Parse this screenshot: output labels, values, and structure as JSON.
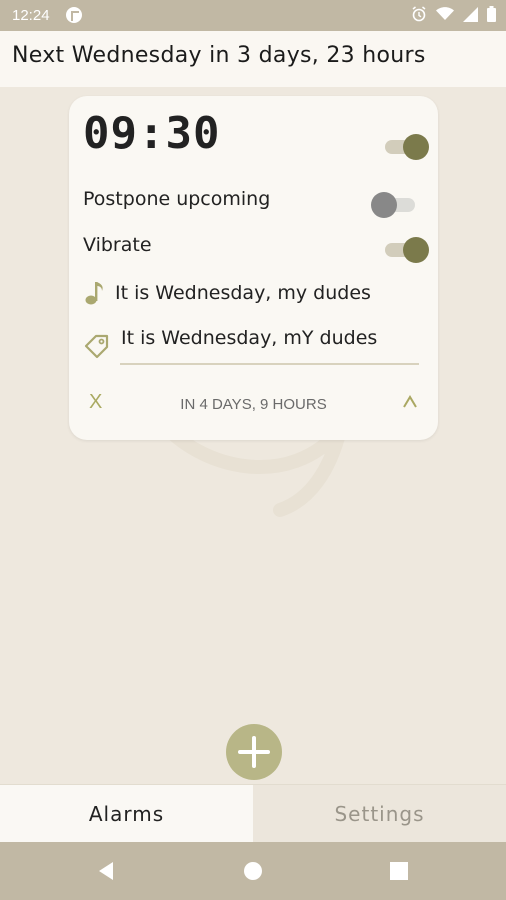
{
  "status_bar": {
    "time": "12:24",
    "icons": [
      "app-notification-icon",
      "alarm-icon",
      "wifi-icon",
      "signal-icon",
      "battery-icon"
    ]
  },
  "header": {
    "title": "Next Wednesday in 3 days, 23 hours"
  },
  "alarm_card": {
    "time": "09:30",
    "enabled": true,
    "postpone_label": "Postpone upcoming",
    "postpone_enabled": false,
    "vibrate_label": "Vibrate",
    "vibrate_enabled": true,
    "ringtone": "It is Wednesday, my dudes",
    "label": "It is Wednesday, mY dudes",
    "delete_label": "X",
    "countdown": "IN 4 DAYS, 9 HOURS",
    "collapse_label": "^"
  },
  "tabs": [
    {
      "label": "Alarms",
      "active": true
    },
    {
      "label": "Settings",
      "active": false
    }
  ],
  "colors": {
    "accent": "#7b7a4b",
    "fab": "#b8b687",
    "bars": "#c1b8a4",
    "background": "#eee8de"
  }
}
